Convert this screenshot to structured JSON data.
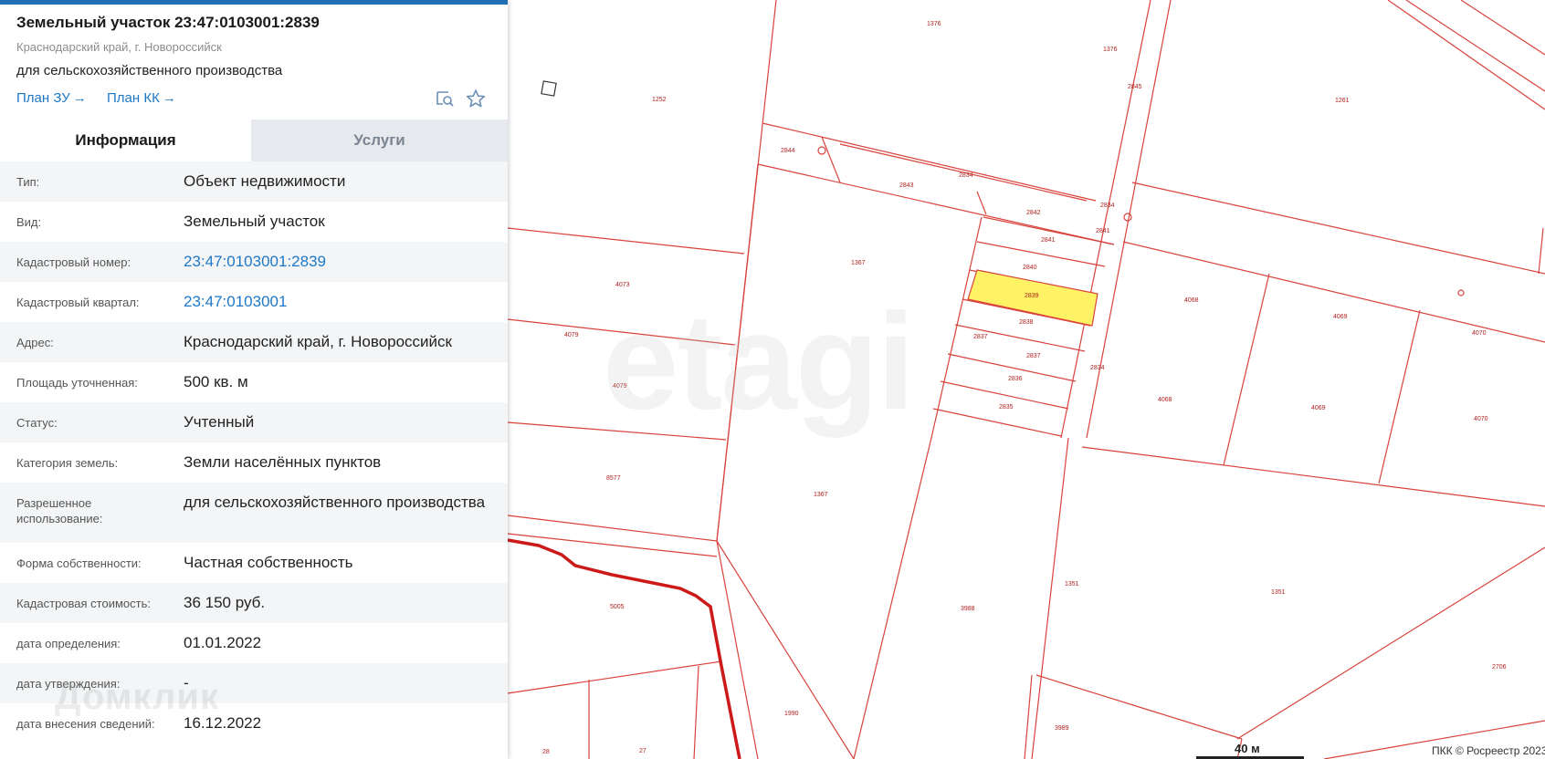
{
  "panel": {
    "title": "Земельный участок 23:47:0103001:2839",
    "region": "Краснодарский край, г. Новороссийск",
    "use": "для сельскохозяйственного производства",
    "plan_zu": "План ЗУ",
    "plan_kk": "План КК",
    "arrow": "→"
  },
  "tabs": {
    "info": "Информация",
    "services": "Услуги"
  },
  "rows": [
    {
      "label": "Тип:",
      "value": "Объект недвижимости"
    },
    {
      "label": "Вид:",
      "value": "Земельный участок"
    },
    {
      "label": "Кадастровый номер:",
      "value": "23:47:0103001:2839"
    },
    {
      "label": "Кадастровый квартал:",
      "value": "23:47:0103001"
    },
    {
      "label": "Адрес:",
      "value": "Краснодарский край, г. Новороссийск"
    },
    {
      "label": "Площадь уточненная:",
      "value": "500 кв. м"
    },
    {
      "label": "Статус:",
      "value": "Учтенный"
    },
    {
      "label": "Категория земель:",
      "value": "Земли населённых пунктов"
    },
    {
      "label": "Разрешенное использование:",
      "value": "для сельскохозяйственного производства"
    },
    {
      "label": "Форма собственности:",
      "value": "Частная собственность"
    },
    {
      "label": "Кадастровая стоимость:",
      "value": "36 150 руб."
    },
    {
      "label": "дата определения:",
      "value": "01.01.2022"
    },
    {
      "label": "дата утверждения:",
      "value": "-"
    },
    {
      "label": "дата внесения сведений:",
      "value": "16.12.2022"
    }
  ],
  "map": {
    "parcel_labels": [
      "1376",
      "1376",
      "1252",
      "2845",
      "1261",
      "2844",
      "2834",
      "2843",
      "2834",
      "2842",
      "2841",
      "2841",
      "1367",
      "2840",
      "4073",
      "2839",
      "2838",
      "4068",
      "4069",
      "4070",
      "4079",
      "2837",
      "2837",
      "4079",
      "2836",
      "2834",
      "2835",
      "4068",
      "4069",
      "4070",
      "8577",
      "1367",
      "1351",
      "1351",
      "5005",
      "3988",
      "2706",
      "1990",
      "3989",
      "28",
      "27"
    ],
    "scale": "40 м",
    "copyright": "ПКК © Росреестр 2023"
  },
  "watermarks": {
    "etagi": "etagi",
    "domclick": "Домклик"
  },
  "colors": {
    "parcel_line": "#d9423c",
    "highlight": "#fff264",
    "road": "#cc1a1a",
    "link": "#1e78c8",
    "accent": "#1e6fb3"
  },
  "icons": {
    "search_map": "search-map-icon",
    "favorite": "star-icon"
  }
}
